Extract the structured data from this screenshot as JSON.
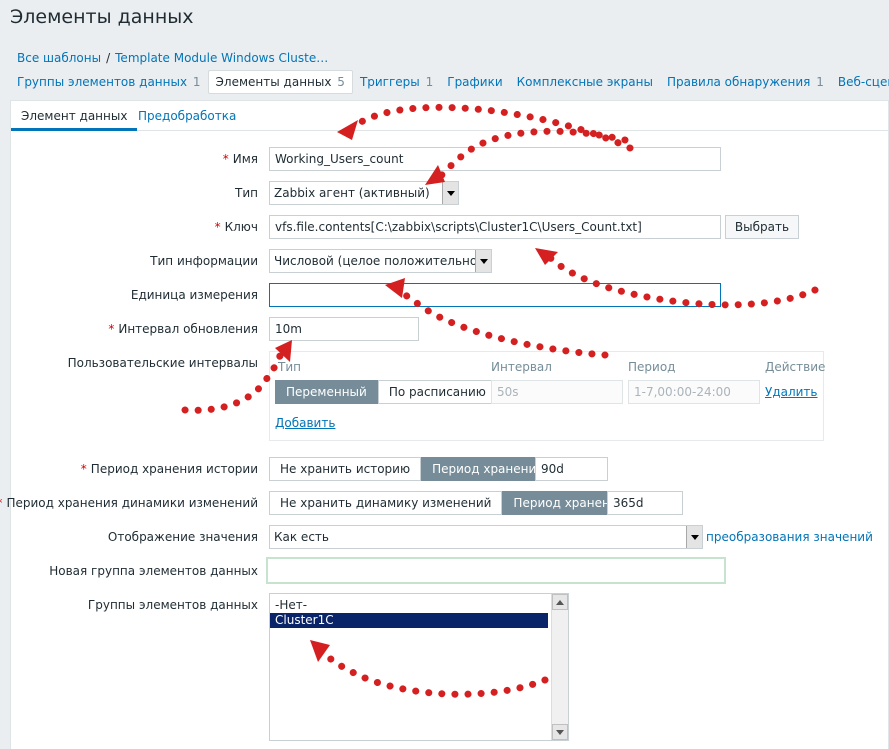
{
  "page": {
    "title": "Элементы данных"
  },
  "breadcrumb": {
    "root": "Все шаблоны",
    "separator": "/",
    "current": "Template Module Windows Cluste…"
  },
  "nav_tabs": [
    {
      "label": "Группы элементов данных",
      "count": "1"
    },
    {
      "label": "Элементы данных",
      "count": "5"
    },
    {
      "label": "Триггеры",
      "count": "1"
    },
    {
      "label": "Графики",
      "count": ""
    },
    {
      "label": "Комплексные экраны",
      "count": ""
    },
    {
      "label": "Правила обнаружения",
      "count": "1"
    },
    {
      "label": "Веб-сценарии",
      "count": ""
    }
  ],
  "subtabs": {
    "item": "Элемент данных",
    "preprocessing": "Предобработка"
  },
  "form": {
    "name": {
      "label": "Имя",
      "value": "Working_Users_count"
    },
    "type": {
      "label": "Тип",
      "value": "Zabbix агент (активный)"
    },
    "key": {
      "label": "Ключ",
      "value": "vfs.file.contents[C:\\zabbix\\scripts\\Cluster1C\\Users_Count.txt]",
      "button": "Выбрать"
    },
    "info_type": {
      "label": "Тип информации",
      "value": "Числовой (целое положительное)"
    },
    "units": {
      "label": "Единица измерения",
      "value": ""
    },
    "interval": {
      "label": "Интервал обновления",
      "value": "10m"
    },
    "custom_intervals": {
      "label": "Пользовательские интервалы",
      "col_type": "Тип",
      "col_interval": "Интервал",
      "col_period": "Период",
      "col_action": "Действие",
      "mode_flexible": "Переменный",
      "mode_scheduling": "По расписанию",
      "interval_value": "50s",
      "period_value": "1-7,00:00-24:00",
      "remove": "Удалить",
      "add": "Добавить"
    },
    "history": {
      "label": "Период хранения истории",
      "opt_off": "Не хранить историю",
      "opt_on": "Период хранения",
      "value": "90d"
    },
    "trends": {
      "label": "Период хранения динамики изменений",
      "opt_off": "Не хранить динамику изменений",
      "opt_on": "Период хранения",
      "value": "365d"
    },
    "valuemap": {
      "label": "Отображение значения",
      "value": "Как есть",
      "link": "преобразования значений"
    },
    "new_app": {
      "label": "Новая группа элементов данных",
      "value": ""
    },
    "applications": {
      "label": "Группы элементов данных",
      "options": [
        "-Нет-",
        "Cluster1C"
      ],
      "selected": "Cluster1C"
    }
  },
  "colors": {
    "link": "#0275b8",
    "required": "#d40000",
    "annotation": "#d42020",
    "segment_on": "#768d99"
  }
}
